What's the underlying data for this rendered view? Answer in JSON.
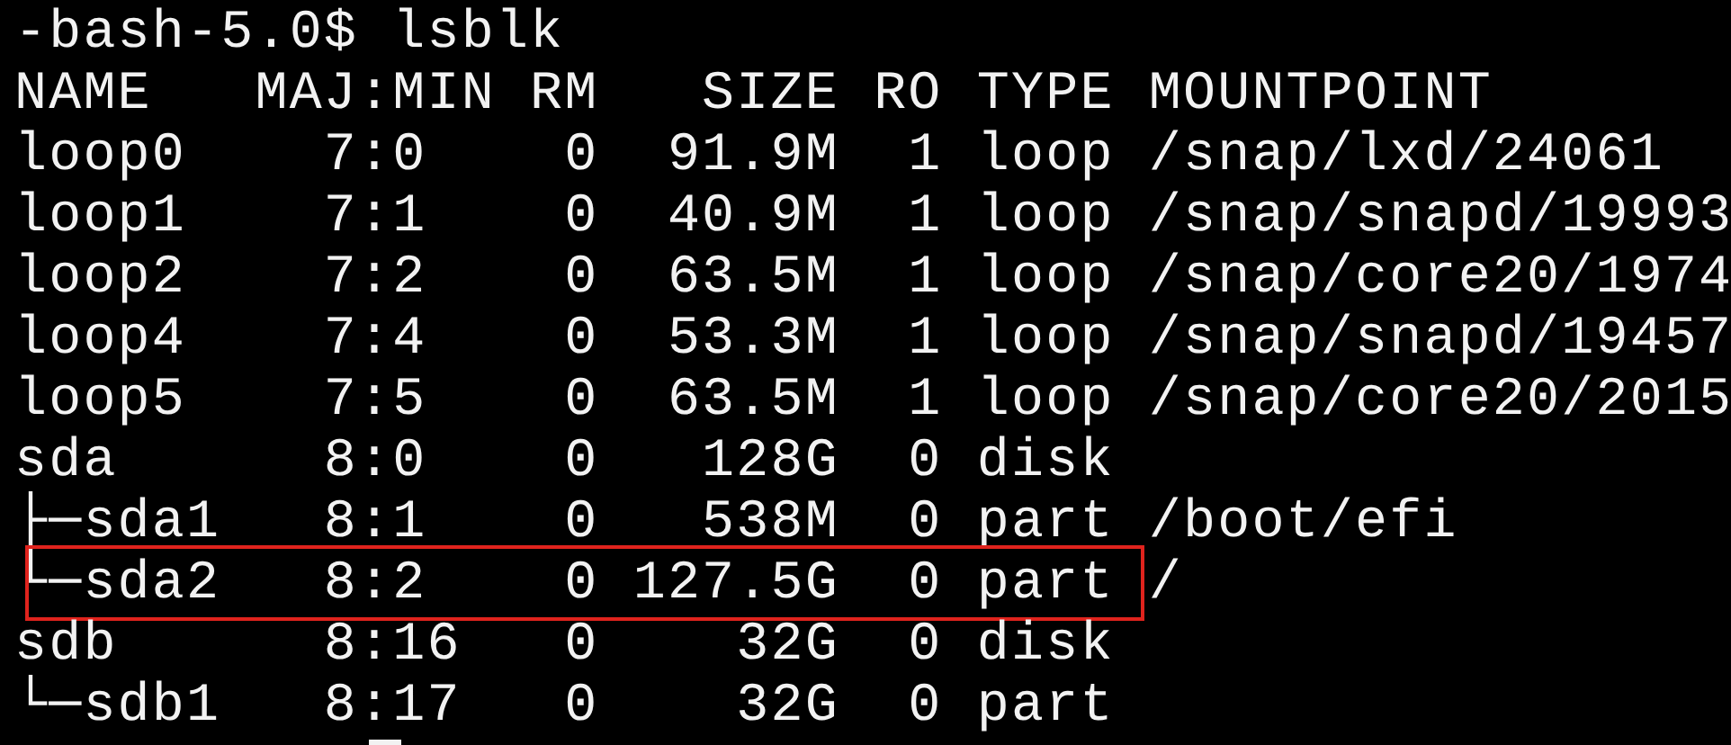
{
  "terminal": {
    "lines": [
      {
        "text": "-bash-5.0$ lsblk",
        "highlighted": false
      },
      {
        "text": "NAME   MAJ:MIN RM   SIZE RO TYPE MOUNTPOINT",
        "highlighted": false
      },
      {
        "text": "loop0    7:0    0  91.9M  1 loop /snap/lxd/24061",
        "highlighted": false
      },
      {
        "text": "loop1    7:1    0  40.9M  1 loop /snap/snapd/19993",
        "highlighted": false
      },
      {
        "text": "loop2    7:2    0  63.5M  1 loop /snap/core20/1974",
        "highlighted": false
      },
      {
        "text": "loop4    7:4    0  53.3M  1 loop /snap/snapd/19457",
        "highlighted": false
      },
      {
        "text": "loop5    7:5    0  63.5M  1 loop /snap/core20/2015",
        "highlighted": false
      },
      {
        "text": "sda      8:0    0   128G  0 disk",
        "highlighted": false
      },
      {
        "text": "├─sda1   8:1    0   538M  0 part /boot/efi",
        "highlighted": false
      },
      {
        "text": "└─sda2   8:2    0 127.5G  0 part /",
        "highlighted": true
      },
      {
        "text": "sdb      8:16   0    32G  0 disk",
        "highlighted": false
      },
      {
        "text": "└─sdb1   8:17   0    32G  0 part",
        "highlighted": false
      }
    ]
  }
}
